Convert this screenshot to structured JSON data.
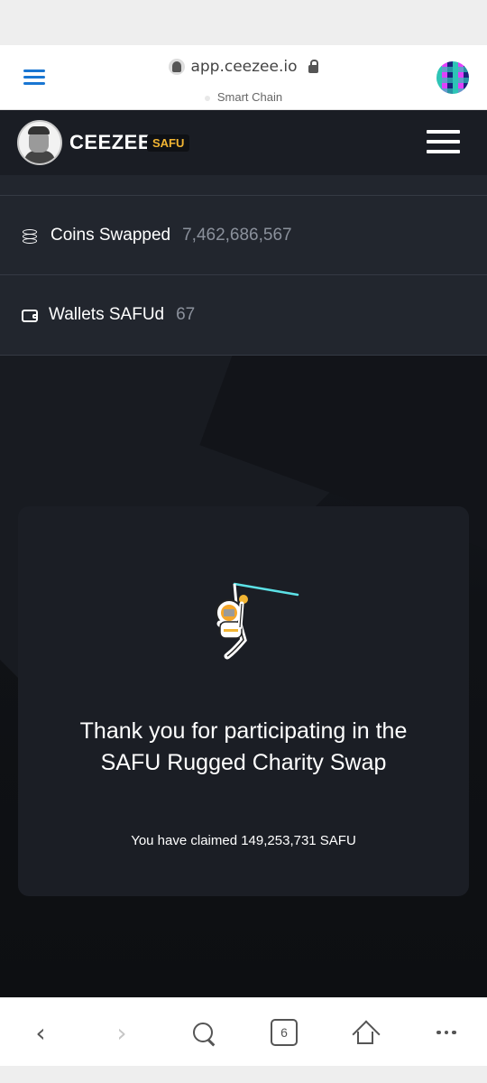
{
  "browser": {
    "url": "app.ceezee.io",
    "network": "Smart Chain",
    "tab_count": "6"
  },
  "app": {
    "brand": "CEEZEE",
    "badge": "SAFU"
  },
  "stats": [
    {
      "label": "Coins Swapped",
      "value": "7,462,686,567",
      "icon": "coins-icon"
    },
    {
      "label": "Wallets SAFUd",
      "value": "67",
      "icon": "wallet-icon"
    }
  ],
  "card": {
    "title": "Thank you for participating in the SAFU Rugged Charity Swap",
    "claimed": "You have claimed 149,253,731 SAFU"
  },
  "colors": {
    "brand_badge": "#f2b533",
    "menu_blue": "#1976d2",
    "laser": "#5ce1e6"
  }
}
